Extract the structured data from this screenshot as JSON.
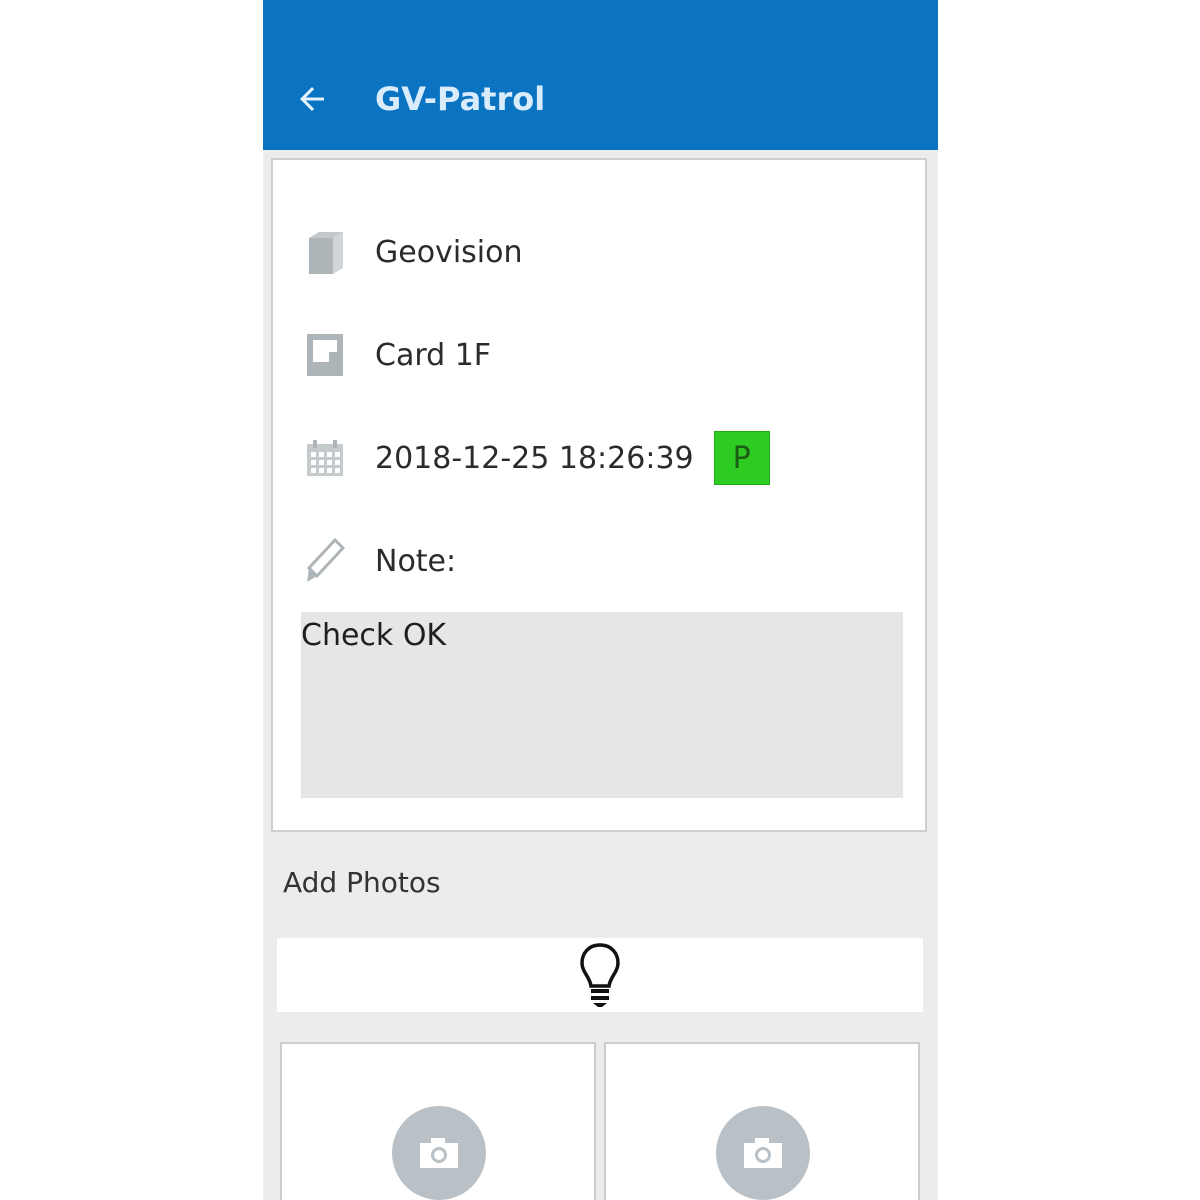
{
  "header": {
    "title": "GV-Patrol",
    "back_icon": "arrow-left-icon",
    "background_color": "#0a74c2"
  },
  "details": {
    "site": {
      "icon": "building-icon",
      "text": "Geovision"
    },
    "checkpoint": {
      "icon": "card-reader-icon",
      "text": "Card 1F"
    },
    "datetime": {
      "icon": "calendar-icon",
      "text": "2018-12-25 18:26:39",
      "badge": "P",
      "badge_color": "#2ecc22"
    },
    "note": {
      "icon": "pencil-icon",
      "label": "Note:",
      "value": "Check OK"
    }
  },
  "photos": {
    "label": "Add Photos",
    "tip_icon": "lightbulb-icon",
    "slot_icon": "camera-icon"
  }
}
